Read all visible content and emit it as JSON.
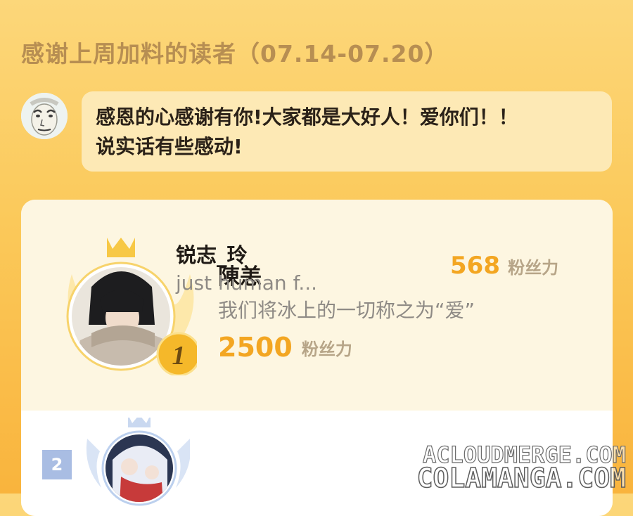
{
  "header": {
    "title": "感谢上周加料的读者（07.14-07.20）"
  },
  "message": {
    "avatar_icon": "meme-face-avatar",
    "lines": [
      "感恩的心感谢有你!大家都是大好人！爱你们！！",
      "说实话有些感动!"
    ]
  },
  "ranking": {
    "entries": [
      {
        "rank": "1",
        "name": "陳恙",
        "motto": "我们将冰上的一切称之为“爱”",
        "fans_value": "2500",
        "fans_label": "粉丝力"
      },
      {
        "rank": "2",
        "name": "锐志_玲",
        "motto": "just human f...",
        "fans_value": "568",
        "fans_label": "粉丝力"
      }
    ]
  },
  "watermark": {
    "line1": "ACLOUDMERGE.COM",
    "line2": "COLAMANGA.COM"
  },
  "colors": {
    "background_top": "#fcd77a",
    "background_bottom": "#f9b43d",
    "accent_gold": "#f3a622",
    "title_brown": "#b78e52",
    "rank2_badge": "#a9bde3"
  }
}
